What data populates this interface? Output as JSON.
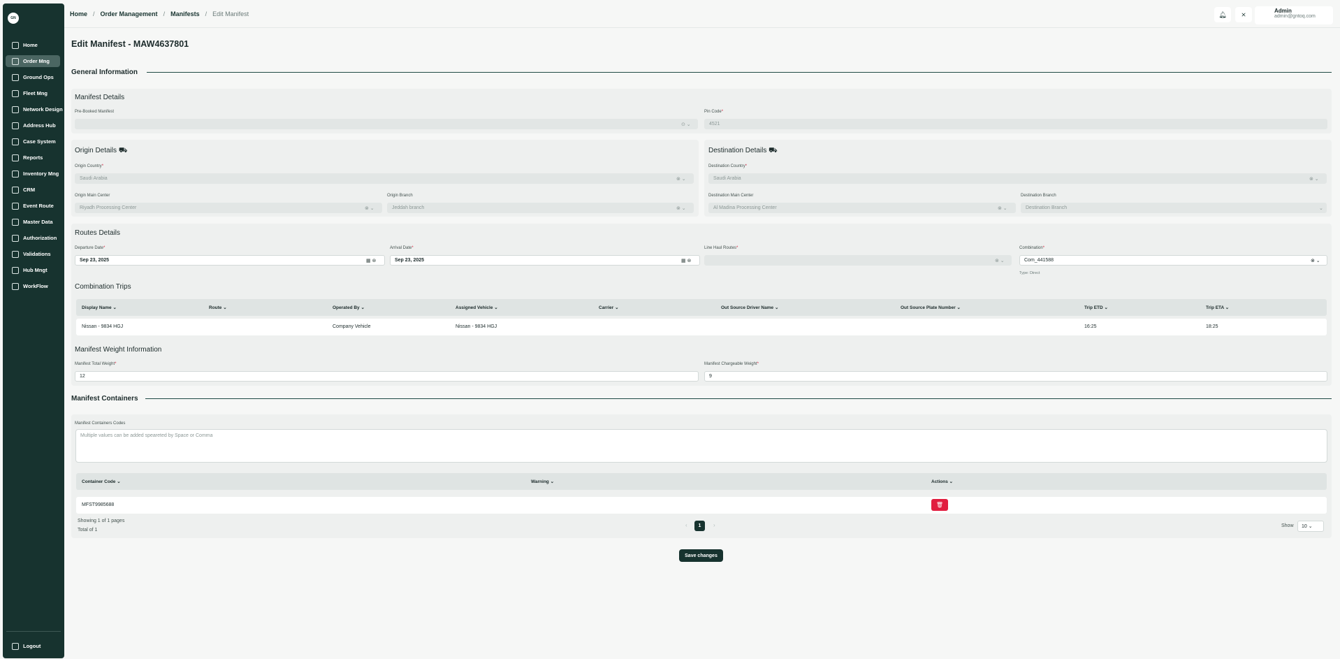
{
  "sidebar": {
    "logo": "GN",
    "items": [
      {
        "label": "Home",
        "icon": "home-icon"
      },
      {
        "label": "Order Mng",
        "icon": "order-icon"
      },
      {
        "label": "Ground Ops",
        "icon": "ground-ops-icon"
      },
      {
        "label": "Fleet Mng",
        "icon": "fleet-icon"
      },
      {
        "label": "Network Design",
        "icon": "network-icon"
      },
      {
        "label": "Address Hub",
        "icon": "address-icon"
      },
      {
        "label": "Case System",
        "icon": "case-icon"
      },
      {
        "label": "Reports",
        "icon": "reports-icon"
      },
      {
        "label": "Inventory Mng",
        "icon": "inventory-icon"
      },
      {
        "label": "CRM",
        "icon": "crm-icon"
      },
      {
        "label": "Event Route",
        "icon": "event-route-icon"
      },
      {
        "label": "Master Data",
        "icon": "master-data-icon"
      },
      {
        "label": "Authorization",
        "icon": "authorization-icon"
      },
      {
        "label": "Validations",
        "icon": "validations-icon"
      },
      {
        "label": "Hub Mngt",
        "icon": "hub-icon"
      },
      {
        "label": "WorkFlow",
        "icon": "workflow-icon"
      }
    ],
    "active_index": 1,
    "logout_label": "Logout"
  },
  "header": {
    "breadcrumb": [
      "Home",
      "Order Management",
      "Manifests",
      "Edit Manifest"
    ],
    "user_name": "Admin",
    "user_email": "admin@gntoq.com"
  },
  "page": {
    "title": "Edit Manifest - MAW4637801",
    "general_information": "General Information",
    "manifest_containers": "Manifest Containers"
  },
  "manifest_details": {
    "title": "Manifest Details",
    "prebooked_label": "Pre-Booked Manifest",
    "prebooked_value": "",
    "pin_label": "Pin Code",
    "pin_value": "4521"
  },
  "origin": {
    "title": "Origin Details",
    "country_label": "Origin Country",
    "country_value": "Saudi Arabia",
    "main_center_label": "Origin Main Center",
    "main_center_value": "Riyadh Processing Center",
    "branch_label": "Origin Branch",
    "branch_value": "Jeddah branch"
  },
  "destination": {
    "title": "Destination Details",
    "country_label": "Destination Country",
    "country_value": "Saudi Arabia",
    "main_center_label": "Destination Main Center",
    "main_center_value": "Al Madina Processing Center",
    "branch_label": "Destination Branch",
    "branch_value": "Destination Branch"
  },
  "routes": {
    "title": "Routes Details",
    "departure_label": "Departure Date",
    "departure_value": "Sep 23, 2025",
    "arrival_label": "Arrival Date",
    "arrival_value": "Sep 23, 2025",
    "linehaul_label": "Line Haul Routes",
    "linehaul_value": "",
    "combination_label": "Combination",
    "combination_value": "Com_441588",
    "combination_type": "Type: Direct"
  },
  "combination_trips": {
    "title": "Combination Trips",
    "columns": [
      "Display Name",
      "Route",
      "Operated By",
      "Assigned Vehicle",
      "Carrier",
      "Out Source Driver Name",
      "Out Source Plate Number",
      "Trip ETD",
      "Trip ETA"
    ],
    "row": [
      "Nissan - 9834 HGJ",
      "",
      "Company Vehicle",
      "Nissan - 9834 HGJ",
      "",
      "",
      "",
      "16:25",
      "18:25"
    ]
  },
  "weight": {
    "title": "Manifest Weight Information",
    "total_label": "Manifest Total Weight",
    "total_value": "12",
    "chargeable_label": "Manifest Chargeable Weight",
    "chargeable_value": "9"
  },
  "containers": {
    "codes_label": "Manifest Containers Codes",
    "codes_placeholder": "Multiple values can be added speareted by Space or Comma",
    "columns": [
      "Container Code",
      "Warning",
      "Actions"
    ],
    "row_code": "MFST9985688",
    "row_warning": "",
    "showing": "Showing 1 of 1 pages",
    "total": "Total of 1",
    "current_page": "1",
    "show_label": "Show",
    "page_size": "10"
  },
  "save_label": "Save changes",
  "colors": {
    "sidebar": "#17332f",
    "danger": "#e11d3f",
    "accent": "#1f4a45"
  }
}
